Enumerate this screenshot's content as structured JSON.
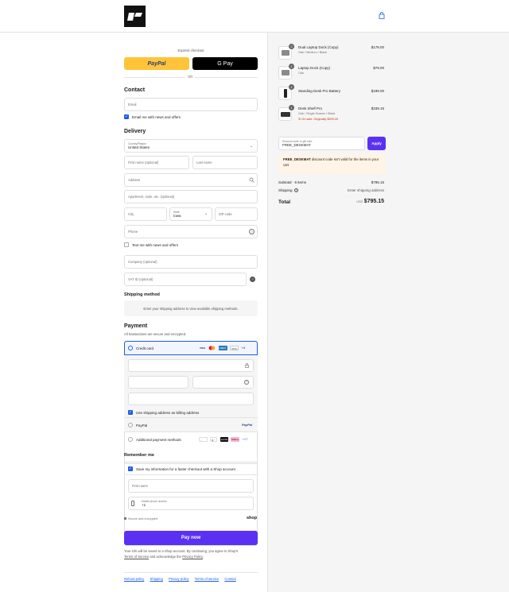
{
  "checkout": {
    "express_label": "Express checkout",
    "paypal_label": "PayPal",
    "gpay_label": "G Pay",
    "or_label": "OR",
    "contact": {
      "heading": "Contact",
      "email_placeholder": "Email",
      "email_news_label": "Email me with news and offers"
    },
    "delivery": {
      "heading": "Delivery",
      "country_label": "Country/Region",
      "country_value": "United States",
      "first_name": "First name (optional)",
      "last_name": "Last name",
      "address": "Address",
      "apartment": "Apartment, suite, etc. (optional)",
      "city": "City",
      "state_label": "State",
      "state_value": "Iowa",
      "zip": "ZIP code",
      "phone": "Phone",
      "text_news_label": "Text me with news and offers",
      "company": "Company (optional)",
      "vat": "VAT ID (optional)"
    },
    "shipping": {
      "heading": "Shipping method",
      "message": "Enter your shipping address to view available shipping methods."
    },
    "payment": {
      "heading": "Payment",
      "secure_note": "All transactions are secure and encrypted.",
      "credit_card_label": "Credit card",
      "card_more": "+4",
      "billing_label": "Use shipping address as billing address",
      "paypal_label": "PayPal",
      "additional_label": "Additional payment methods",
      "additional_more": "+17"
    },
    "remember": {
      "heading": "Remember me",
      "save_label": "Save my information for a faster checkout with a Shop account",
      "first_name": "First name",
      "mobile_label": "Mobile phone number",
      "mobile_value": "+1",
      "secure_label": "Secure and encrypted",
      "shop_label": "shop"
    },
    "pay_now": "Pay now",
    "disclaimer_pre": "Your info will be saved to a Shop account. By continuing, you agree to Shop's",
    "terms_label": "Terms of Service",
    "disclaimer_mid": "and acknowledge the",
    "privacy_label": "Privacy Policy",
    "footer_links": [
      "Refund policy",
      "Shipping",
      "Privacy policy",
      "Terms of service",
      "Contact"
    ]
  },
  "summary": {
    "items": [
      {
        "name": "Dual Laptop Dock (Copy)",
        "variant": "Oak / Medium / Black",
        "price": "$178.00",
        "qty": "2"
      },
      {
        "name": "Laptop Dock (Copy)",
        "variant": "Oak",
        "price": "$79.00",
        "qty": "1"
      },
      {
        "name": "Standing Desk Pro Battery",
        "variant": "",
        "price": "$199.00",
        "qty": "1"
      },
      {
        "name": "Desk Shelf Pro",
        "variant": "Oak / Single Drawer / Black",
        "price": "$339.15",
        "qty": "1",
        "sale": "On sale: Originally $399.00"
      }
    ],
    "discount_label": "Discount code or gift card",
    "discount_value": "FREE_DESKMAT",
    "apply_label": "Apply",
    "warning_code": "FREE_DESKMAT",
    "warning_text": "discount code isn't valid for the items in your cart",
    "subtotal_label": "Subtotal · 5 items",
    "subtotal_value": "$795.15",
    "shipping_label": "Shipping",
    "shipping_value": "Enter shipping address",
    "total_label": "Total",
    "currency": "USD",
    "total_value": "$795.15"
  },
  "colors": {
    "accent": "#5a31f4",
    "link": "#1c5ce6",
    "paypal": "#ffc439",
    "warning_bg": "#fff4e5"
  }
}
